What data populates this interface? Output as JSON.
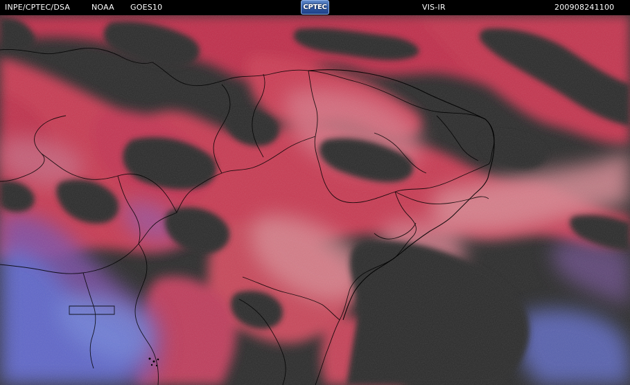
{
  "header": {
    "source": "INPE/CPTEC/DSA",
    "agency": "NOAA",
    "satellite": "GOES10",
    "logo_text": "CPTEC",
    "channel": "VIS-IR",
    "timestamp": "200908241100"
  },
  "colors": {
    "background": "#000000",
    "clear_sky": "#2b2b2b",
    "cloud_red": "#c8324a",
    "cloud_magenta": "#b04a78",
    "cloud_pink": "#d97a86",
    "cloud_violet": "#8a5ab8",
    "cloud_blue": "#5a74d8",
    "boundary_lines": "#000000"
  },
  "map": {
    "type": "satellite-composite",
    "layers": [
      "cloud-cover",
      "state-boundaries",
      "coastline"
    ]
  }
}
